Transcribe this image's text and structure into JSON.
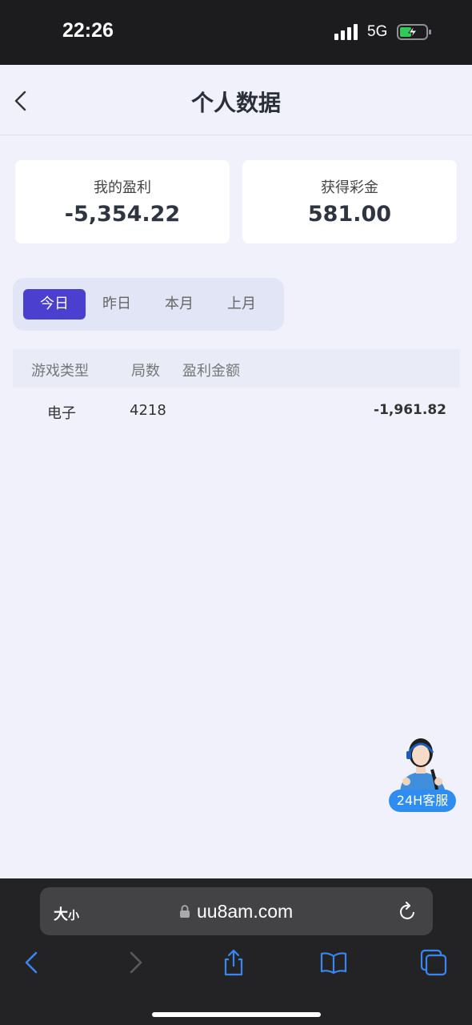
{
  "status": {
    "time": "22:26",
    "network": "5G"
  },
  "header": {
    "title": "个人数据"
  },
  "cards": [
    {
      "label": "我的盈利",
      "value": "-5,354.22"
    },
    {
      "label": "获得彩金",
      "value": "581.00"
    }
  ],
  "tabs": [
    {
      "label": "今日",
      "active": true
    },
    {
      "label": "昨日",
      "active": false
    },
    {
      "label": "本月",
      "active": false
    },
    {
      "label": "上月",
      "active": false
    }
  ],
  "table": {
    "headers": [
      "游戏类型",
      "局数",
      "盈利金额"
    ],
    "rows": [
      {
        "type": "电子",
        "count": "4218",
        "amount": "-1,961.82"
      }
    ]
  },
  "service": {
    "label": "24H客服"
  },
  "browser": {
    "text_size_big": "大",
    "text_size_small": "小",
    "url": "uu8am.com"
  },
  "colors": {
    "accent": "#4a3fcf",
    "service": "#2f8cf1",
    "background": "#f0f1fa"
  }
}
